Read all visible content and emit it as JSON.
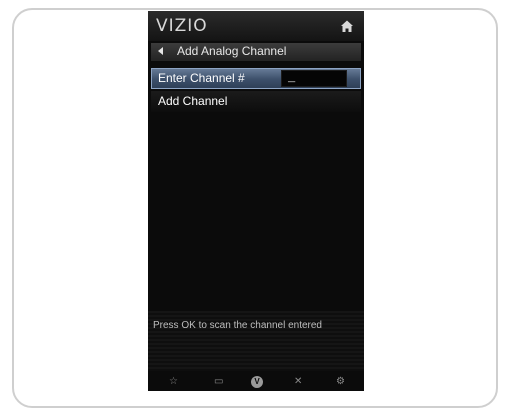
{
  "header": {
    "logo_text": "VIZIO",
    "home_icon": "home-icon"
  },
  "title_bar": {
    "back_icon": "back-arrow-icon",
    "title": "Add Analog Channel"
  },
  "menu": {
    "items": [
      {
        "label": "Enter Channel #",
        "input_value": "_",
        "selected": true
      },
      {
        "label": "Add Channel",
        "selected": false
      }
    ]
  },
  "hint": {
    "text": "Press OK to scan the channel entered"
  },
  "bottom_bar": {
    "icons": [
      {
        "name": "star-icon",
        "glyph": "☆"
      },
      {
        "name": "menu-icon",
        "glyph": "▭"
      },
      {
        "name": "v-button-icon",
        "glyph": "V"
      },
      {
        "name": "close-icon",
        "glyph": "✕"
      },
      {
        "name": "settings-icon",
        "glyph": "⚙"
      }
    ]
  },
  "colors": {
    "panel_background": "#0b0b0b",
    "selected_row": "#3c4f6a",
    "text": "#ffffff"
  }
}
